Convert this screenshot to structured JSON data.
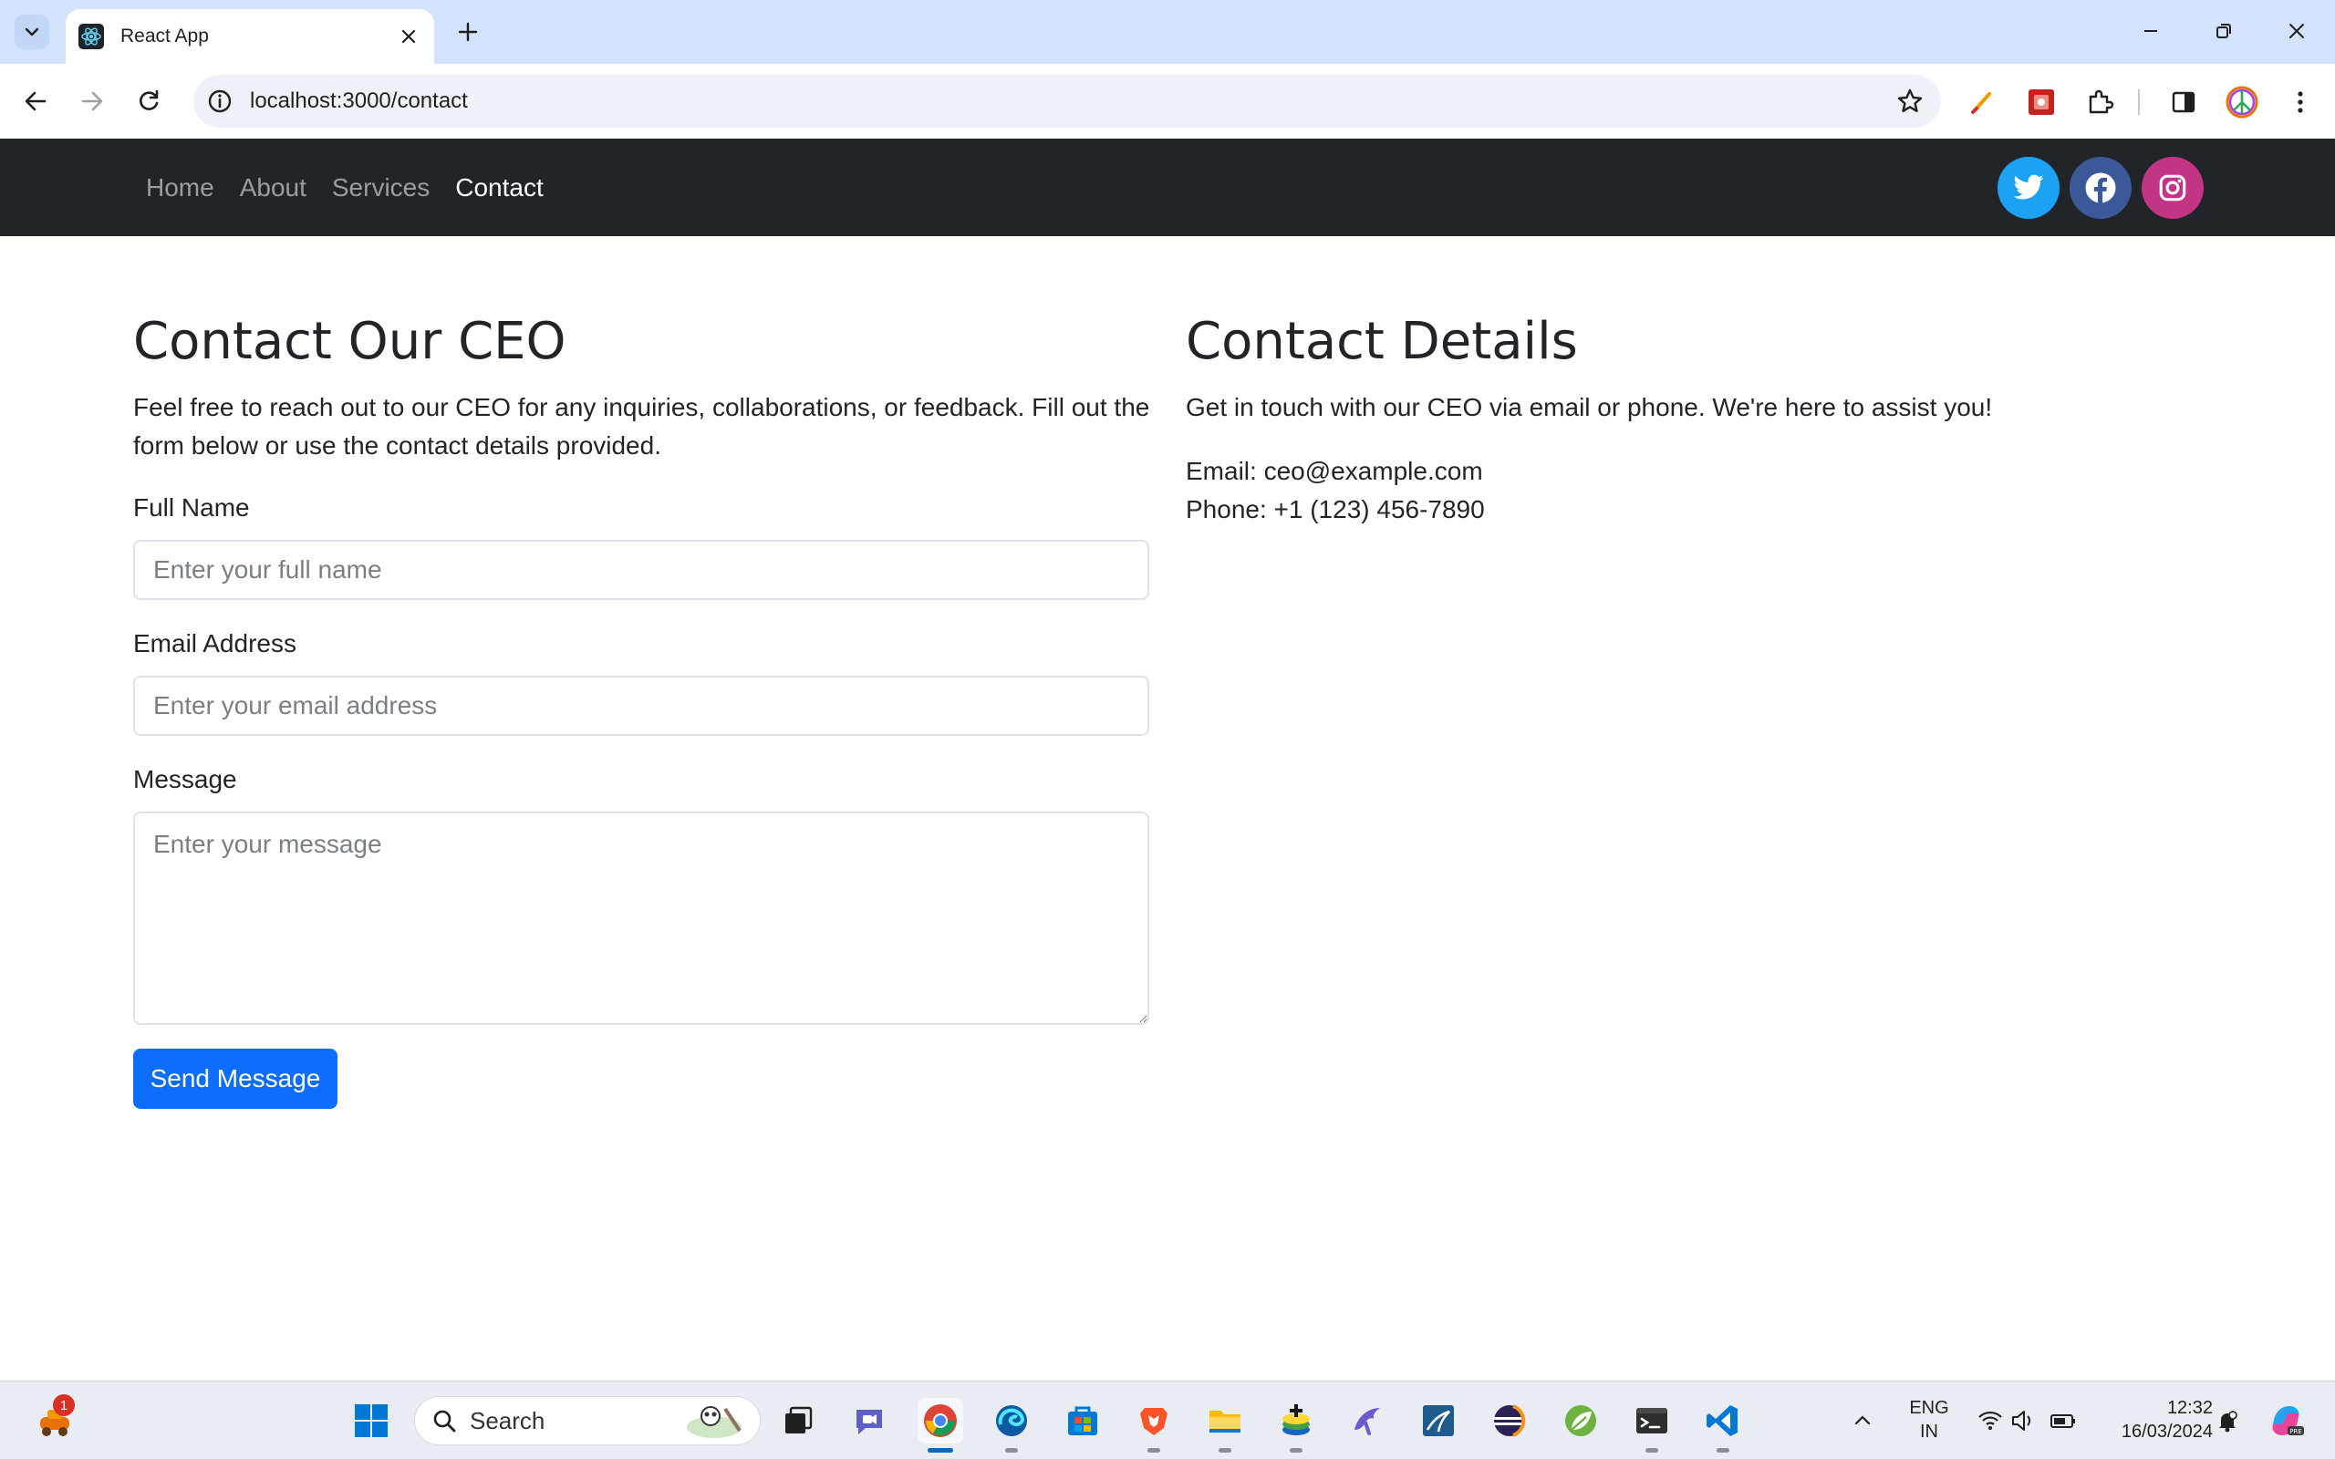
{
  "browser": {
    "tab_title": "React App",
    "url": "localhost:3000/contact"
  },
  "navbar": {
    "links": [
      "Home",
      "About",
      "Services",
      "Contact"
    ],
    "active": "Contact",
    "social": [
      "twitter",
      "facebook",
      "instagram"
    ],
    "colors": {
      "twitter": "#1da1f2",
      "facebook": "#3b5998",
      "instagram": "#c13584",
      "bg": "#212529"
    }
  },
  "contact_form": {
    "title": "Contact Our CEO",
    "intro_line1": "Feel free to reach out to our CEO for any inquiries, collaborations, or feedback. Fill out the",
    "intro_line2": "form below or use the contact details provided.",
    "full_name_label": "Full Name",
    "full_name_placeholder": "Enter your full name",
    "email_label": "Email Address",
    "email_placeholder": "Enter your email address",
    "message_label": "Message",
    "message_placeholder": "Enter your message",
    "submit_label": "Send Message",
    "submit_color": "#0d6efd"
  },
  "contact_details": {
    "title": "Contact Details",
    "intro": "Get in touch with our CEO via email or phone. We're here to assist you!",
    "email_line": "Email: ceo@example.com",
    "phone_line": "Phone: +1 (123) 456-7890"
  },
  "taskbar": {
    "search_label": "Search",
    "notification_count": "1",
    "lang_line1": "ENG",
    "lang_line2": "IN",
    "time": "12:32",
    "date": "16/03/2024"
  }
}
